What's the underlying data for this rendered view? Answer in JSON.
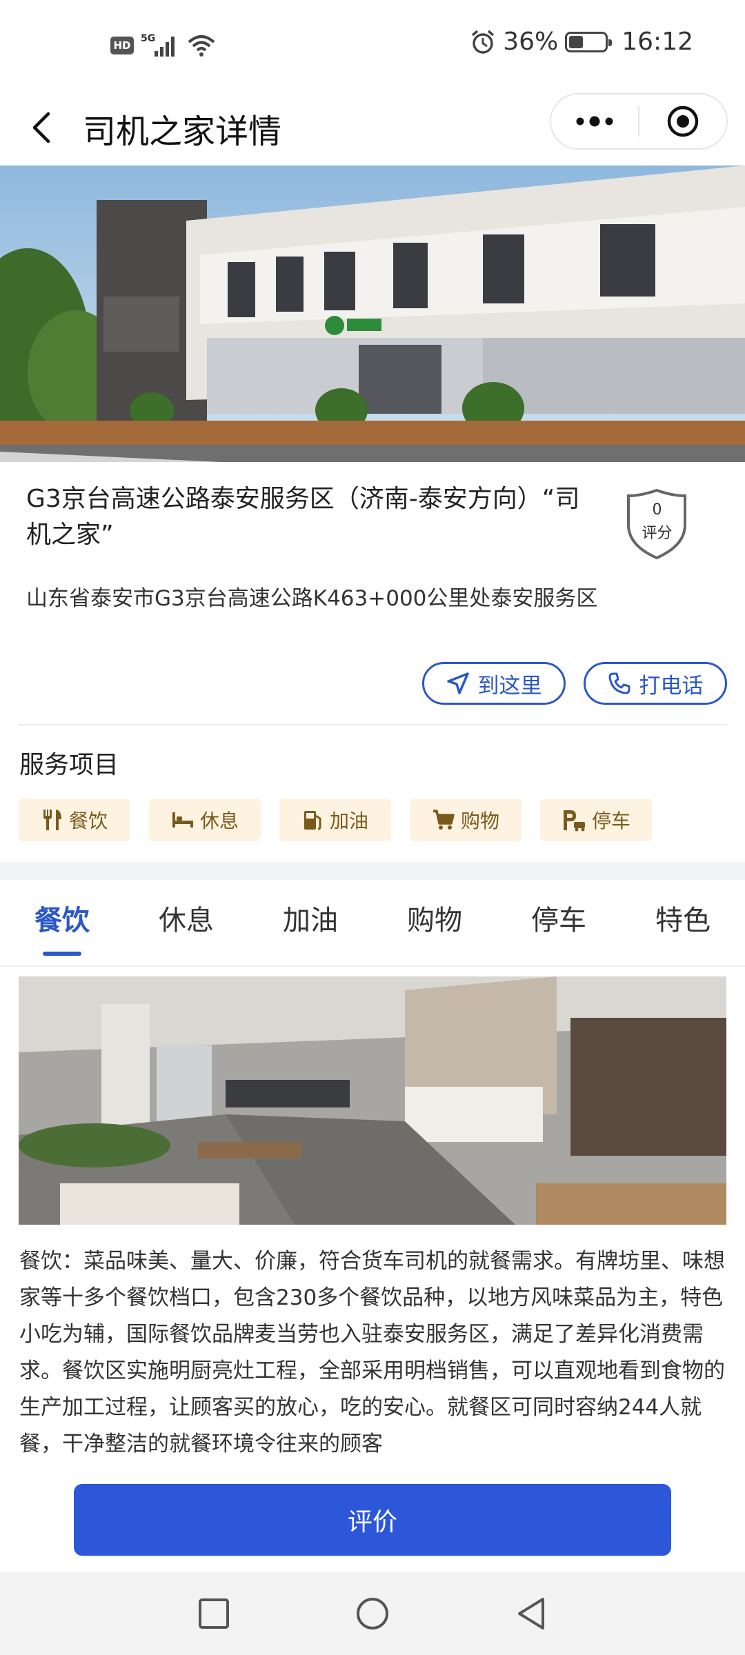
{
  "status_bar": {
    "hd": "HD",
    "network": "5G",
    "battery_percent": "36%",
    "battery_level": 0.36,
    "time": "16:12"
  },
  "header": {
    "title": "司机之家详情"
  },
  "place": {
    "name": "G3京台高速公路泰安服务区（济南-泰安方向）“司机之家”",
    "rating_value": "0",
    "rating_label": "评分",
    "address": "山东省泰安市G3京台高速公路K463+000公里处泰安服务区"
  },
  "actions": {
    "navigate_label": "到这里",
    "call_label": "打电话"
  },
  "services": {
    "title": "服务项目",
    "items": [
      {
        "label": "餐饮",
        "icon": "utensils-icon"
      },
      {
        "label": "休息",
        "icon": "bed-icon"
      },
      {
        "label": "加油",
        "icon": "fuel-pump-icon"
      },
      {
        "label": "购物",
        "icon": "cart-icon"
      },
      {
        "label": "停车",
        "icon": "parking-icon"
      }
    ]
  },
  "tabs": [
    "餐饮",
    "休息",
    "加油",
    "购物",
    "停车",
    "特色"
  ],
  "active_tab": "餐饮",
  "content": {
    "description": "餐饮：菜品味美、量大、价廉，符合货车司机的就餐需求。有牌坊里、味想家等十多个餐饮档口，包含230多个餐饮品种，以地方风味菜品为主，特色小吃为辅，国际餐饮品牌麦当劳也入驻泰安服务区，满足了差异化消费需求。餐饮区实施明厨亮灶工程，全部采用明档销售，可以直观地看到食物的生产加工过程，让顾客买的放心，吃的安心。就餐区可同时容纳244人就餐，干净整洁的就餐环境令往来的顾客"
  },
  "review_button": "评价",
  "colors": {
    "accent": "#2b57c9",
    "chip_bg": "#fdf3e0",
    "chip_text": "#7a5a1c"
  }
}
